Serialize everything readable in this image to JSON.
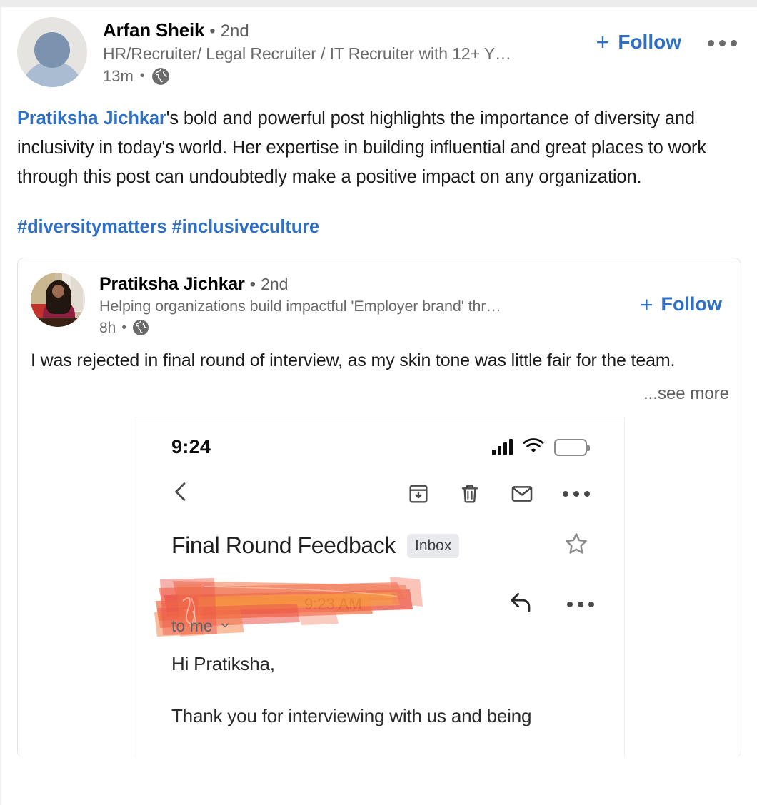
{
  "post": {
    "author": {
      "name": "Arfan Sheik",
      "separator": "•",
      "degree": "2nd",
      "headline": "HR/Recruiter/ Legal Recruiter / IT Recruiter with 12+ Y…",
      "time": "13m",
      "time_separator": "•",
      "visibility_icon": "globe-icon",
      "avatar_icon": "default-avatar-placeholder"
    },
    "follow_label": "Follow",
    "follow_plus": "+",
    "overflow_icon": "more-options-icon",
    "body_mention": "Pratiksha Jichkar",
    "body_text": "'s bold and powerful post highlights the importance of diversity and inclusivity in today's world. Her expertise in building influential and great places to work through this post can undoubtedly make a positive impact on any organization.",
    "hashtags": "#diversitymatters #inclusiveculture"
  },
  "reshare": {
    "author": {
      "name": "Pratiksha Jichkar",
      "separator": "•",
      "degree": "2nd",
      "headline": "Helping organizations build impactful 'Employer brand' thr…",
      "time": "8h",
      "time_separator": "•",
      "visibility_icon": "globe-icon",
      "avatar_icon": "profile-photo"
    },
    "follow_label": "Follow",
    "follow_plus": "+",
    "body_text": "I was rejected in final round of interview, as my skin tone was little fair for the team.",
    "see_more_label": "...see more"
  },
  "embedded_screenshot": {
    "status_bar": {
      "time": "9:24",
      "signal_icon": "cellular-signal-icon",
      "wifi_icon": "wifi-icon",
      "battery_icon": "battery-icon"
    },
    "toolbar": {
      "back_icon": "back-chevron-icon",
      "archive_icon": "archive-icon",
      "delete_icon": "trash-icon",
      "unread_icon": "mail-icon",
      "more_icon": "more-options-icon"
    },
    "email": {
      "subject": "Final Round Feedback",
      "label_chip": "Inbox",
      "star_icon": "star-outline-icon",
      "sender_redacted_text": "9:23 AM",
      "recipient": "to me",
      "recipient_chevron_icon": "chevron-down-icon",
      "reply_icon": "reply-arrow-icon",
      "more_icon": "more-options-icon",
      "body_line_1": "Hi Pratiksha,",
      "body_line_2": "Thank you for interviewing with us and being"
    }
  },
  "colors": {
    "linkedin_blue": "#2f6fc4",
    "text_primary": "#1b1b1b",
    "text_muted": "#6b6b6b",
    "card_border": "#e2e2e2",
    "redaction_orange": "#f05a28",
    "redaction_red": "#e8382a"
  }
}
